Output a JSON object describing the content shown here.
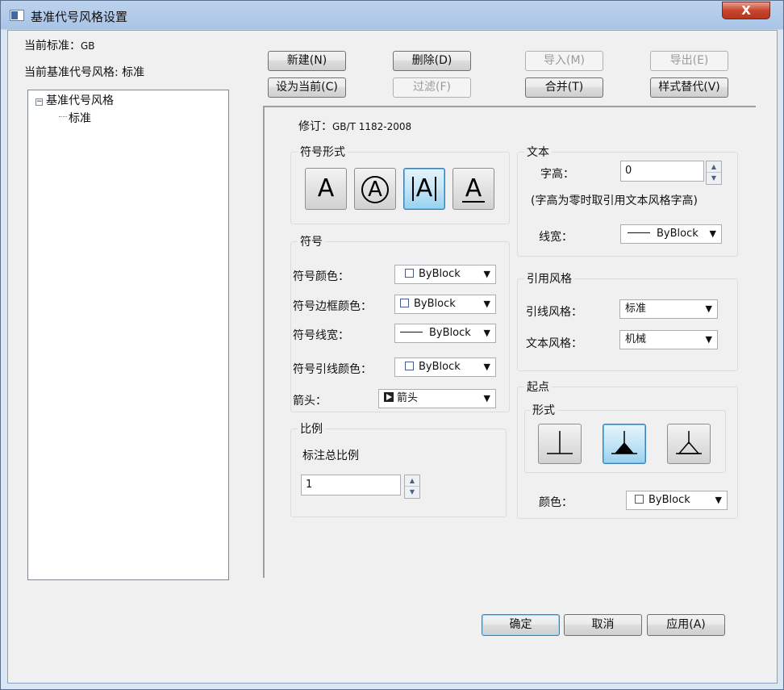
{
  "window": {
    "title": "基准代号风格设置",
    "close_label": "X"
  },
  "header": {
    "current_standard_label": "当前标准：",
    "current_standard_value": "GB",
    "current_style_label": "当前基准代号风格:",
    "current_style_value": "标准"
  },
  "tree": {
    "root": "基准代号风格",
    "children": [
      "标准"
    ]
  },
  "buttons": {
    "new": "新建(N)",
    "delete": "删除(D)",
    "import": "导入(M)",
    "export": "导出(E)",
    "set_current": "设为当前(C)",
    "filter": "过滤(F)",
    "merge": "合并(T)",
    "style_replace": "样式替代(V)",
    "ok": "确定",
    "cancel": "取消",
    "apply": "应用(A)"
  },
  "revision": {
    "label": "修订：",
    "value": "GB/T 1182-2008"
  },
  "symbol_form": {
    "title": "符号形式",
    "options": [
      "A",
      "A",
      "A",
      "A"
    ],
    "selected_index": 2
  },
  "text": {
    "title": "文本",
    "height_label": "字高：",
    "height_value": "0",
    "note": "(字高为零时取引用文本风格字高)",
    "line_width_label": "线宽：",
    "line_width_value": "ByBlock"
  },
  "symbol": {
    "title": "符号",
    "color_label": "符号颜色：",
    "color_value": "ByBlock",
    "frame_color_label": "符号边框颜色：",
    "frame_color_value": "ByBlock",
    "line_width_label": "符号线宽：",
    "line_width_value": "ByBlock",
    "leader_color_label": "符号引线颜色：",
    "leader_color_value": "ByBlock",
    "arrow_label": "箭头：",
    "arrow_value": "箭头"
  },
  "ref_style": {
    "title": "引用风格",
    "leader_label": "引线风格：",
    "leader_value": "标准",
    "text_label": "文本风格：",
    "text_value": "机械"
  },
  "scale": {
    "title": "比例",
    "label": "标注总比例",
    "value": "1"
  },
  "start": {
    "title": "起点",
    "form_title": "形式",
    "selected_index": 1,
    "color_label": "颜色：",
    "color_value": "ByBlock"
  },
  "colors": {
    "selected_border": "#3c7fb1",
    "swatch_border": "#4a5a8a"
  }
}
